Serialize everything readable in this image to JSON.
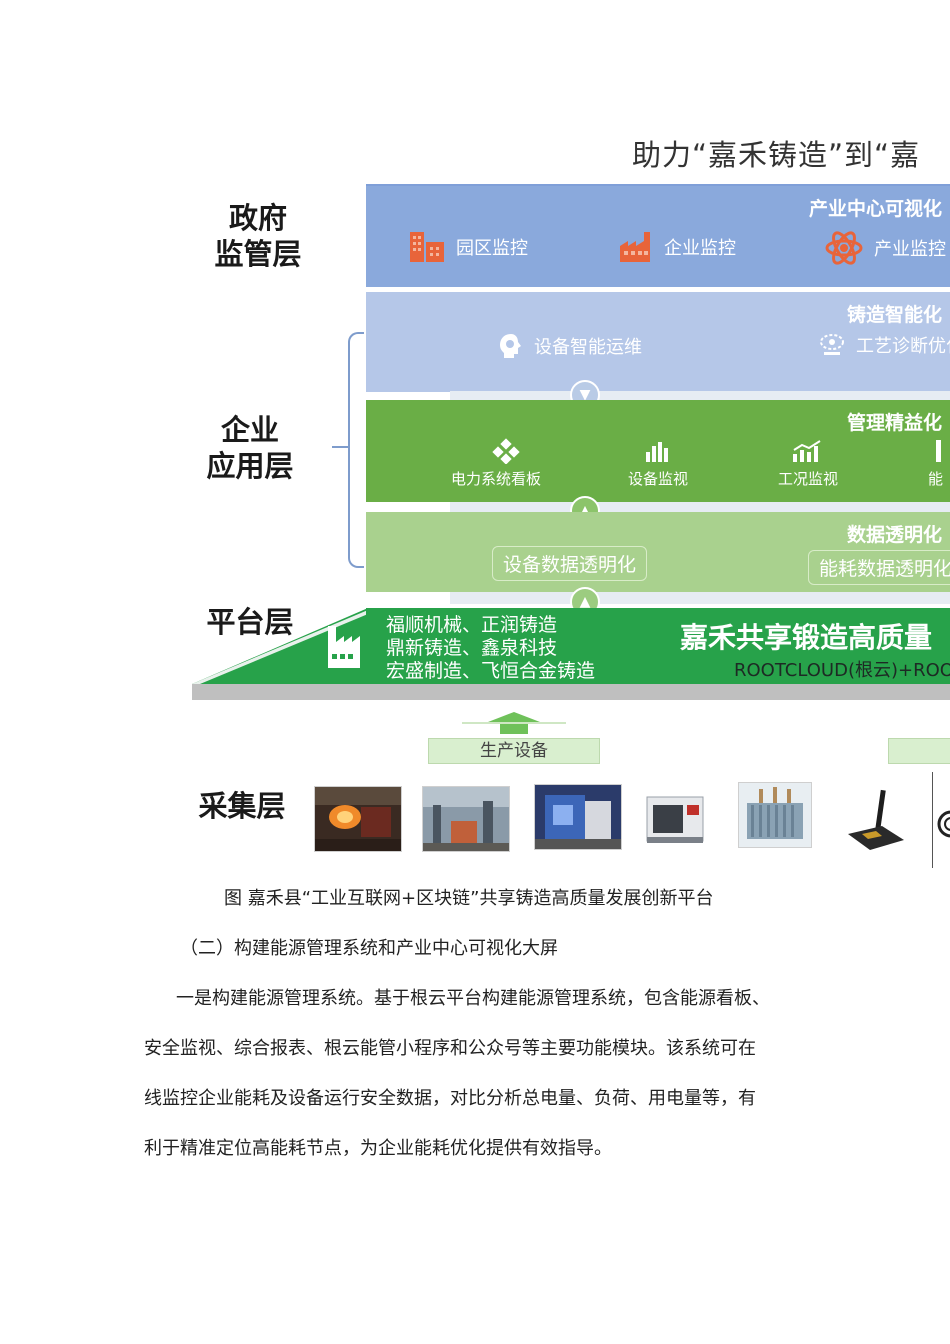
{
  "figure": {
    "title": "助力“嘉禾铸造”到“嘉",
    "layers": {
      "government": "政府\n监管层",
      "enterprise": "企业\n应用层",
      "platform": "平台层",
      "collection": "采集层"
    },
    "gov_band": {
      "header": "产业中心可视化",
      "items": [
        {
          "icon": "buildings-icon",
          "label": "园区监控"
        },
        {
          "icon": "factory-icon",
          "label": "企业监控"
        },
        {
          "icon": "atom-icon",
          "label": "产业监控"
        }
      ]
    },
    "smart_band": {
      "header": "铸造智能化",
      "items": [
        {
          "icon": "head-gear-icon",
          "label": "设备智能运维"
        },
        {
          "icon": "diagnosis-icon",
          "label": "工艺诊断优化"
        }
      ]
    },
    "mgmt_band": {
      "header": "管理精益化",
      "items": [
        {
          "icon": "power-icon",
          "label": "电力系统看板"
        },
        {
          "icon": "bar-chart-icon",
          "label": "设备监视"
        },
        {
          "icon": "line-chart-icon",
          "label": "工况监视"
        },
        {
          "icon": "energy-icon",
          "label": "能"
        }
      ]
    },
    "data_band": {
      "header": "数据透明化",
      "pills": [
        "设备数据透明化",
        "能耗数据透明化"
      ]
    },
    "platform": {
      "firms": [
        "福顺机械、正润铸造",
        "鼎新铸造、鑫泉科技",
        "宏盛制造、飞恒合金铸造"
      ],
      "main": "嘉禾共享锻造高质量",
      "sub": "ROOTCLOUD(根云)+ROOT"
    },
    "production_label": "生产设备",
    "photos": [
      "foundry-molten-metal-photo",
      "workshop-photo",
      "furnace-machine-photo",
      "cnc-machine-photo",
      "transformer-photo",
      "antenna-gateway-photo",
      "cable-sensor-photo"
    ]
  },
  "caption": "图 嘉禾县“工业互联网+区块链”共享铸造高质量发展创新平台",
  "section_heading": "（二）构建能源管理系统和产业中心可视化大屏",
  "paragraph_lines": [
    "一是构建能源管理系统。基于根云平台构建能源管理系统，包含能源看板、",
    "安全监视、综合报表、根云能管小程序和公众号等主要功能模块。该系统可在",
    "线监控企业能耗及设备运行安全数据，对比分析总电量、负荷、用电量等，有",
    "利于精准定位高能耗节点，为企业能耗优化提供有效指导。"
  ],
  "colors": {
    "gov": "#8aa9dc",
    "smart": "#b5c7e8",
    "mgmt": "#6aae46",
    "data": "#a9d18e",
    "platform": "#27a24a",
    "icon_orange": "#e8643a"
  }
}
